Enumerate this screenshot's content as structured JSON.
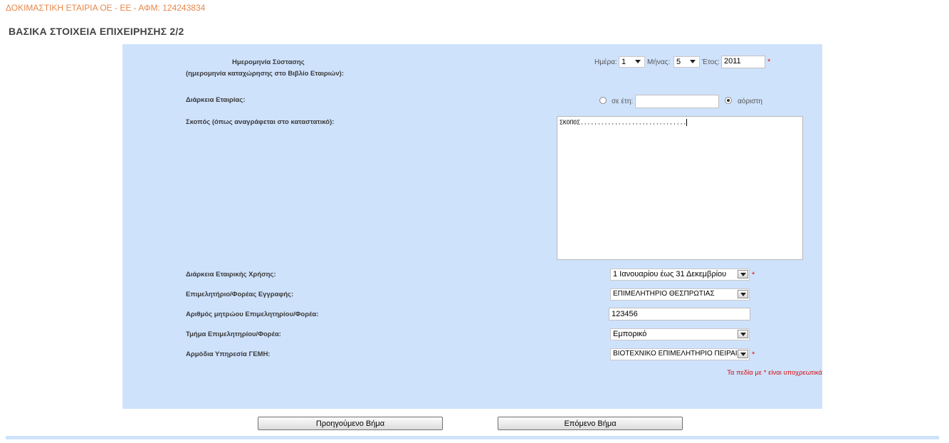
{
  "header": {
    "company": "ΔΟΚΙΜΑΣΤΙΚΗ ΕΤΑΙΡΙΑ ΟΕ - ΕΕ - ΑΦΜ: 124243834",
    "title": "ΒΑΣΙΚΑ ΣΤΟΙΧΕΙΑ ΕΠΙΧΕΙΡΗΣΗΣ 2/2"
  },
  "form": {
    "founding_label_1": "Ημερομηνία Σύστασης",
    "founding_label_2": "(ημερομηνία καταχώρησης στο Βιβλίο Εταιριών):",
    "day_label": "Ημέρα:",
    "day_value": "1",
    "month_label": "Μήνας:",
    "month_value": "5",
    "year_label": "Έτος:",
    "year_value": "2011",
    "required_mark": "*",
    "duration_label": "Διάρκεια Εταιρίας:",
    "duration_years_label": "σε έτη:",
    "duration_years_value": "",
    "duration_indefinite_label": "αόριστη",
    "purpose_label": "Σκοπός (όπως αναγράφεται στο καταστατικό):",
    "purpose_value": "ΣΚΟΠΟΣ...............................",
    "fiscal_label": "Διάρκεια Εταιρικής Χρήσης:",
    "fiscal_value": "1 Ιανουαρίου έως 31 Δεκεμβρίου",
    "chamber_label": "Επιμελητήριο/Φορέας Εγγραφής:",
    "chamber_value": "ΕΠΙΜΕΛΗΤΗΡΙΟ ΘΕΣΠΡΩΤΙΑΣ",
    "registry_label": "Αριθμός μητρώου Επιμελητηρίου/Φορέα:",
    "registry_value": "123456",
    "department_label": "Τμήμα Επιμελητηρίου/Φορέα:",
    "department_value": "Εμπορικό",
    "gemi_label": "Αρμόδια Υπηρεσία ΓΕΜΗ:",
    "gemi_value": "ΒΙΟΤΕΧΝΙΚΟ ΕΠΙΜΕΛΗΤΗΡΙΟ ΠΕΙΡΑΙΩΣ",
    "required_note": "Τα πεδία με * είναι υποχρεωτικά"
  },
  "buttons": {
    "previous": "Προηγούμενο Βήμα",
    "next": "Επόμενο Βήμα"
  },
  "colors": {
    "panel": "#cfe2fc",
    "company_text": "#e8874a",
    "required": "#e01818"
  }
}
